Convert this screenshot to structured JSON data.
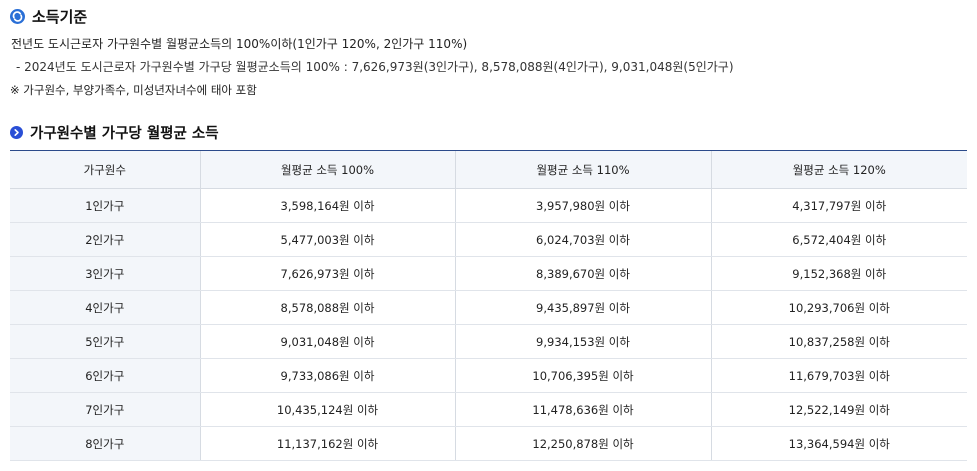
{
  "heading": {
    "title": "소득기준",
    "icon": "refresh-logo-icon",
    "icon_color": "#2a6fd6"
  },
  "criteria": {
    "line1": "전년도 도시근로자 가구원수별 월평균소득의 100%이하(1인가구 120%, 2인가구 110%)",
    "line2": "- 2024년도 도시근로자 가구원수별 가구당 월평균소득의 100% : 7,626,973원(3인가구), 8,578,088원(4인가구), 9,031,048원(5인가구)",
    "note": "※ 가구원수, 부양가족수, 미성년자녀수에 태아 포함"
  },
  "section": {
    "title": "가구원수별 가구당 월평균 소득",
    "icon": "circle-chevron-icon",
    "icon_color": "#2a4fd6"
  },
  "table": {
    "headers": [
      "가구원수",
      "월평균 소득 100%",
      "월평균 소득 110%",
      "월평균 소득 120%"
    ],
    "rows": [
      [
        "1인가구",
        "3,598,164원 이하",
        "3,957,980원 이하",
        "4,317,797원 이하"
      ],
      [
        "2인가구",
        "5,477,003원 이하",
        "6,024,703원 이하",
        "6,572,404원 이하"
      ],
      [
        "3인가구",
        "7,626,973원 이하",
        "8,389,670원 이하",
        "9,152,368원 이하"
      ],
      [
        "4인가구",
        "8,578,088원 이하",
        "9,435,897원 이하",
        "10,293,706원 이하"
      ],
      [
        "5인가구",
        "9,031,048원 이하",
        "9,934,153원 이하",
        "10,837,258원 이하"
      ],
      [
        "6인가구",
        "9,733,086원 이하",
        "10,706,395원 이하",
        "11,679,703원 이하"
      ],
      [
        "7인가구",
        "10,435,124원 이하",
        "11,478,636원 이하",
        "12,522,149원 이하"
      ],
      [
        "8인가구",
        "11,137,162원 이하",
        "12,250,878원 이하",
        "13,364,594원 이하"
      ]
    ]
  }
}
